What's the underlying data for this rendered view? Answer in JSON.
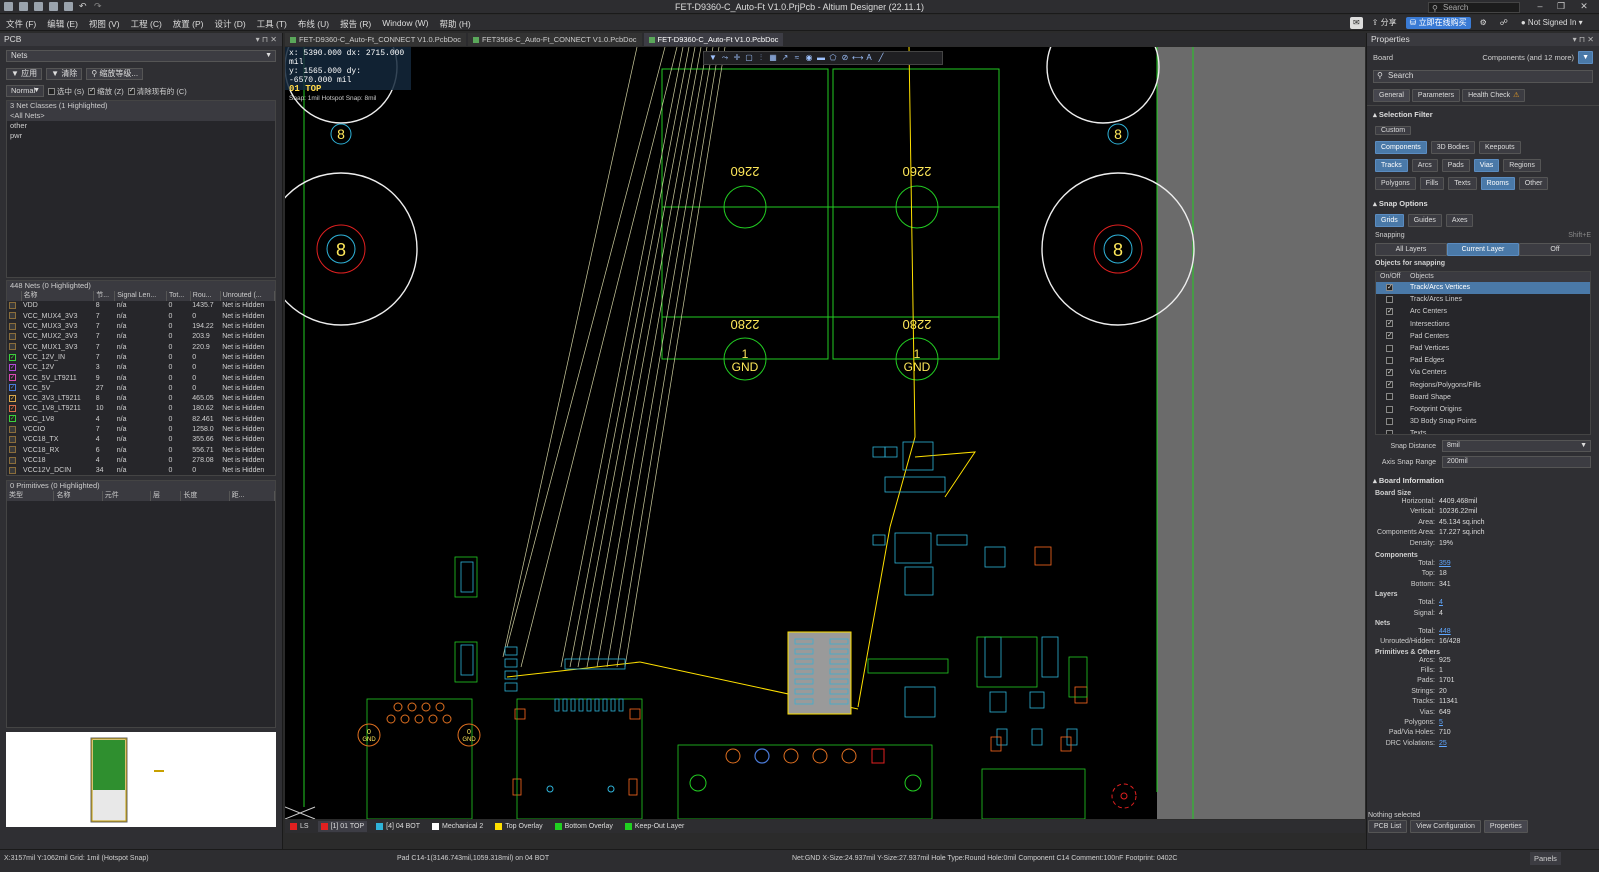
{
  "titlebar": {
    "title": "FET-D9360-C_Auto-Ft  V1.0.PrjPcb - Altium Designer (22.11.1)",
    "search_placeholder": "Search"
  },
  "menu": {
    "items": [
      "文件 (F)",
      "编辑 (E)",
      "视图 (V)",
      "工程 (C)",
      "放置 (P)",
      "设计 (D)",
      "工具 (T)",
      "布线 (U)",
      "报告 (R)",
      "Window (W)",
      "帮助 (H)"
    ],
    "share": "分享",
    "buy": "立即在线购买",
    "user": "Not Signed In"
  },
  "leftpanel": {
    "title": "PCB",
    "mode": "Nets",
    "apply": "应用",
    "clear": "清除",
    "zoom_level": "缩放等级...",
    "filter_mode": "Normal",
    "opt_select": "选中 (S)",
    "opt_zoom": "缩放 (Z)",
    "opt_clear": "清除现有的 (C)",
    "classes_header": "3 Net Classes (1 Highlighted)",
    "classes": [
      "<All Nets>",
      "other",
      "pwr"
    ],
    "nets_header": "448 Nets (0 Highlighted)",
    "net_columns": [
      "名称",
      "节...",
      "Signal Len...",
      "Tot...",
      "Rou...",
      "Unrouted (..."
    ],
    "nets": [
      {
        "name": "VDD",
        "nodes": "8",
        "sig": "n/a",
        "tot": "0",
        "rou": "1435.7",
        "unrouted": "Net is Hidden",
        "color": "#8a6d3b",
        "checked": false
      },
      {
        "name": "VCC_MUX4_3V3",
        "nodes": "7",
        "sig": "n/a",
        "tot": "0",
        "rou": "0",
        "unrouted": "Net is Hidden",
        "color": "#8a6d3b",
        "checked": false
      },
      {
        "name": "VCC_MUX3_3V3",
        "nodes": "7",
        "sig": "n/a",
        "tot": "0",
        "rou": "194.22",
        "unrouted": "Net is Hidden",
        "color": "#8a6d3b",
        "checked": false
      },
      {
        "name": "VCC_MUX2_3V3",
        "nodes": "7",
        "sig": "n/a",
        "tot": "0",
        "rou": "203.9",
        "unrouted": "Net is Hidden",
        "color": "#8a6d3b",
        "checked": false
      },
      {
        "name": "VCC_MUX1_3V3",
        "nodes": "7",
        "sig": "n/a",
        "tot": "0",
        "rou": "220.9",
        "unrouted": "Net is Hidden",
        "color": "#8a6d3b",
        "checked": false
      },
      {
        "name": "VCC_12V_IN",
        "nodes": "7",
        "sig": "n/a",
        "tot": "0",
        "rou": "0",
        "unrouted": "Net is Hidden",
        "color": "#3bd13b",
        "checked": true
      },
      {
        "name": "VCC_12V",
        "nodes": "3",
        "sig": "n/a",
        "tot": "0",
        "rou": "0",
        "unrouted": "Net is Hidden",
        "color": "#b04bd9",
        "checked": true
      },
      {
        "name": "VCC_5V_LT9211",
        "nodes": "9",
        "sig": "n/a",
        "tot": "0",
        "rou": "0",
        "unrouted": "Net is Hidden",
        "color": "#d94bb4",
        "checked": true
      },
      {
        "name": "VCC_5V",
        "nodes": "27",
        "sig": "n/a",
        "tot": "0",
        "rou": "0",
        "unrouted": "Net is Hidden",
        "color": "#4b7bd9",
        "checked": true
      },
      {
        "name": "VCC_3V3_LT9211",
        "nodes": "8",
        "sig": "n/a",
        "tot": "0",
        "rou": "465.05",
        "unrouted": "Net is Hidden",
        "color": "#d9a84b",
        "checked": true
      },
      {
        "name": "VCC_1V8_LT9211",
        "nodes": "10",
        "sig": "n/a",
        "tot": "0",
        "rou": "180.62",
        "unrouted": "Net is Hidden",
        "color": "#d96d4b",
        "checked": true
      },
      {
        "name": "VCC_1V8",
        "nodes": "4",
        "sig": "n/a",
        "tot": "0",
        "rou": "82.461",
        "unrouted": "Net is Hidden",
        "color": "#3bd13b",
        "checked": true
      },
      {
        "name": "VCCIO",
        "nodes": "7",
        "sig": "n/a",
        "tot": "0",
        "rou": "1258.0",
        "unrouted": "Net is Hidden",
        "color": "#8a6d3b",
        "checked": false
      },
      {
        "name": "VCC18_TX",
        "nodes": "4",
        "sig": "n/a",
        "tot": "0",
        "rou": "355.66",
        "unrouted": "Net is Hidden",
        "color": "#8a6d3b",
        "checked": false
      },
      {
        "name": "VCC18_RX",
        "nodes": "6",
        "sig": "n/a",
        "tot": "0",
        "rou": "556.71",
        "unrouted": "Net is Hidden",
        "color": "#8a6d3b",
        "checked": false
      },
      {
        "name": "VCC18",
        "nodes": "4",
        "sig": "n/a",
        "tot": "0",
        "rou": "278.08",
        "unrouted": "Net is Hidden",
        "color": "#8a6d3b",
        "checked": false
      },
      {
        "name": "VCC12V_DCIN",
        "nodes": "34",
        "sig": "n/a",
        "tot": "0",
        "rou": "0",
        "unrouted": "Net is Hidden",
        "color": "#8a6d3b",
        "checked": false
      }
    ],
    "prims_header": "0 Primitives (0 Highlighted)",
    "prim_columns": [
      "类型",
      "名称",
      "元件",
      "层",
      "长度",
      "距..."
    ]
  },
  "tabs": [
    {
      "label": "FET-D9360-C_Auto-Ft_CONNECT V1.0.PcbDoc",
      "active": false
    },
    {
      "label": "FET3568-C_Auto-Ft_CONNECT V1.0.PcbDoc",
      "active": false
    },
    {
      "label": "FET-D9360-C_Auto-Ft  V1.0.PcbDoc",
      "active": true
    }
  ],
  "hud": {
    "line1": "x:  5390.000   dx:  2715.000  mil",
    "line2": "y:  1565.000   dy: -6570.000  mil",
    "layer": "01 TOP",
    "snap": "Snap: 1mil Hotspot Snap: 8mil"
  },
  "board": {
    "label_2260": "2260",
    "label_2280": "2280",
    "pad_num": "1",
    "gnd": "GND",
    "hole_num": "8",
    "small_gnd_num": "0"
  },
  "layers": [
    {
      "label": "LS",
      "color": "#e02020"
    },
    {
      "label": "[1] 01 TOP",
      "color": "#e02020"
    },
    {
      "label": "[4] 04 BOT",
      "color": "#2fb3d9"
    },
    {
      "label": "Mechanical 2",
      "color": "#ffffff"
    },
    {
      "label": "Top Overlay",
      "color": "#ffe000"
    },
    {
      "label": "Bottom Overlay",
      "color": "#20d020"
    },
    {
      "label": "Keep-Out Layer",
      "color": "#20d020"
    }
  ],
  "rightpanel": {
    "title": "Properties",
    "board_label": "Board",
    "board_value": "Components (and 12 more)",
    "search_placeholder": "Search",
    "tabs": [
      "General",
      "Parameters",
      "Health Check"
    ],
    "selection_filter": "Selection Filter",
    "custom": "Custom",
    "filters_row1": [
      "Components",
      "3D Bodies",
      "Keepouts"
    ],
    "filters_row2": [
      "Tracks",
      "Arcs",
      "Pads",
      "Vias",
      "Regions"
    ],
    "filters_row3": [
      "Polygons",
      "Fills",
      "Texts",
      "Rooms",
      "Other"
    ],
    "snap_options": "Snap Options",
    "snap_row": [
      "Grids",
      "Guides",
      "Axes"
    ],
    "snapping": "Snapping",
    "snapping_key": "Shift+E",
    "snap_modes": [
      "All Layers",
      "Current Layer",
      "Off"
    ],
    "objects_for_snapping": "Objects for snapping",
    "obj_cols": [
      "On/Off",
      "Objects"
    ],
    "objects": [
      {
        "label": "Track/Arcs Vertices",
        "on": true,
        "sel": true
      },
      {
        "label": "Track/Arcs Lines",
        "on": false,
        "sel": false
      },
      {
        "label": "Arc Centers",
        "on": true,
        "sel": false
      },
      {
        "label": "Intersections",
        "on": true,
        "sel": false
      },
      {
        "label": "Pad Centers",
        "on": true,
        "sel": false
      },
      {
        "label": "Pad Vertices",
        "on": false,
        "sel": false
      },
      {
        "label": "Pad Edges",
        "on": false,
        "sel": false
      },
      {
        "label": "Via Centers",
        "on": true,
        "sel": false
      },
      {
        "label": "Regions/Polygons/Fills",
        "on": true,
        "sel": false
      },
      {
        "label": "Board Shape",
        "on": false,
        "sel": false
      },
      {
        "label": "Footprint Origins",
        "on": false,
        "sel": false
      },
      {
        "label": "3D Body Snap Points",
        "on": false,
        "sel": false
      },
      {
        "label": "Texts",
        "on": false,
        "sel": false
      }
    ],
    "snap_distance_label": "Snap Distance",
    "snap_distance": "8mil",
    "axis_snap_label": "Axis Snap Range",
    "axis_snap": "200mil",
    "board_information": "Board Information",
    "board_size": "Board Size",
    "size": [
      {
        "k": "Horizontal:",
        "v": "4409.468mil"
      },
      {
        "k": "Vertical:",
        "v": "10236.22mil"
      },
      {
        "k": "Area:",
        "v": "45.134 sq.inch"
      },
      {
        "k": "Components Area:",
        "v": "17.227 sq.inch"
      },
      {
        "k": "Density:",
        "v": "19%"
      }
    ],
    "components": "Components",
    "comp": [
      {
        "k": "Total:",
        "v": "359",
        "link": true
      },
      {
        "k": "Top:",
        "v": "18",
        "link": false
      },
      {
        "k": "Bottom:",
        "v": "341",
        "link": false
      }
    ],
    "layers_h": "Layers",
    "lay": [
      {
        "k": "Total:",
        "v": "4",
        "link": true
      },
      {
        "k": "Signal:",
        "v": "4",
        "link": false
      }
    ],
    "nets_h": "Nets",
    "nets": [
      {
        "k": "Total:",
        "v": "448",
        "link": true
      },
      {
        "k": "Unrouted/Hidden:",
        "v": "16/428",
        "link": false
      }
    ],
    "prims_h": "Primitives & Others",
    "prims": [
      {
        "k": "Arcs:",
        "v": "925",
        "link": false
      },
      {
        "k": "Fills:",
        "v": "1",
        "link": false
      },
      {
        "k": "Pads:",
        "v": "1701",
        "link": false
      },
      {
        "k": "Strings:",
        "v": "20",
        "link": false
      },
      {
        "k": "Tracks:",
        "v": "11341",
        "link": false
      },
      {
        "k": "Vias:",
        "v": "649",
        "link": false
      },
      {
        "k": "Polygons:",
        "v": "5",
        "link": true
      },
      {
        "k": "Pad/Via Holes:",
        "v": "710",
        "link": false
      },
      {
        "k": "DRC Violations:",
        "v": "25",
        "link": true
      }
    ],
    "nothing_selected": "Nothing selected",
    "bottom_tabs": [
      "PCB List",
      "View Configuration",
      "Properties"
    ],
    "panels": "Panels"
  },
  "status": {
    "coords": "X:3157mil Y:1062mil   Grid: 1mil     (Hotspot Snap)",
    "pad": "Pad C14-1(3146.743mil,1059.318mil) on 04 BOT",
    "info": "Net:GND X-Size:24.937mil Y-Size:27.937mil Hole Type:Round Hole:0mil   Component C14 Comment:100nF Footprint: 0402C"
  }
}
